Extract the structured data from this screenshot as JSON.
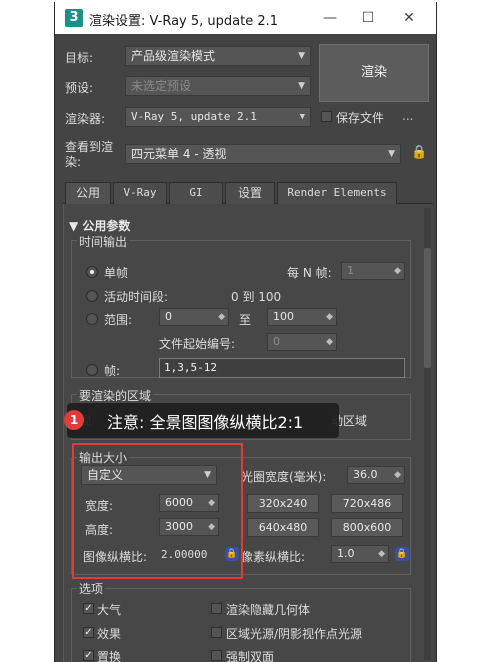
{
  "window": {
    "title": "渲染设置: V-Ray 5, update 2.1",
    "logo": "3",
    "minimize": "—",
    "maximize": "☐",
    "close": "✕"
  },
  "header": {
    "target_label": "目标:",
    "target_value": "产品级渲染模式",
    "preset_label": "预设:",
    "preset_value": "未选定预设",
    "renderer_label": "渲染器:",
    "renderer_value": "V-Ray 5, update 2.1",
    "save_file_label": "保存文件",
    "more": "...",
    "view_label": "查看到渲染:",
    "view_value": "四元菜单 4 - 透视",
    "render_button": "渲染"
  },
  "tabs": [
    "公用",
    "V-Ray",
    "GI",
    "设置",
    "Render Elements"
  ],
  "common": {
    "rollout_title": "▼ 公用参数",
    "time_output": {
      "title": "时间输出",
      "single": "单帧",
      "every_n_label": "每 N 帧:",
      "every_n_value": "1",
      "active_segment": "活动时间段:",
      "active_range": "0 到 100",
      "range": "范围:",
      "range_from": "0",
      "range_to_label": "至",
      "range_to": "100",
      "file_start_label": "文件起始编号:",
      "file_start_value": "0",
      "frames_label": "帧:",
      "frames_value": "1,3,5-12"
    },
    "area": {
      "title": "要渲染的区域",
      "left_glyph": "视",
      "right_text": "动区域"
    },
    "output_size": {
      "title": "输出大小",
      "preset": "自定义",
      "aperture_label": "光圈宽度(毫米):",
      "aperture_value": "36.0",
      "width_label": "宽度:",
      "width_value": "6000",
      "height_label": "高度:",
      "height_value": "3000",
      "presets": [
        "320x240",
        "720x486",
        "640x480",
        "800x600"
      ],
      "aspect_label": "图像纵横比:",
      "aspect_value": "2.00000",
      "pixel_aspect_label": "像素纵横比:",
      "pixel_aspect_value": "1.0"
    },
    "options": {
      "title": "选项",
      "atmosphere": "大气",
      "render_hidden": "渲染隐藏几何体",
      "effects": "效果",
      "area_lights": "区域光源/阴影视作点光源",
      "displacement": "置换",
      "force_double": "强制双面"
    }
  },
  "annotation": {
    "number": "1",
    "text": "注意: 全景图图像纵横比2:1",
    "highlight_color": "#e23b3b"
  }
}
